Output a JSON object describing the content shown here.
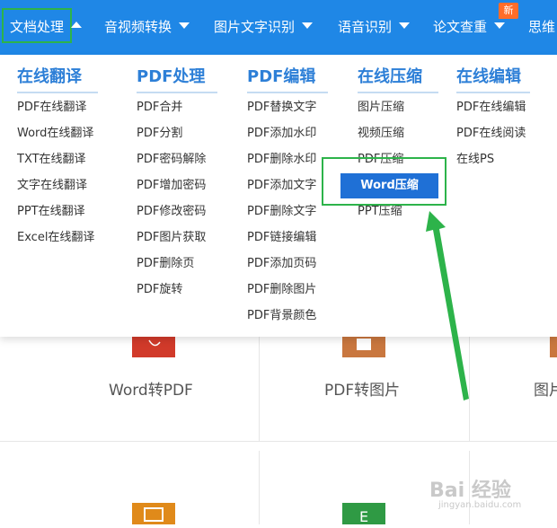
{
  "nav": {
    "items": [
      {
        "label": "文档处理",
        "active": true
      },
      {
        "label": "音视频转换"
      },
      {
        "label": "图片文字识别"
      },
      {
        "label": "语音识别"
      },
      {
        "label": "论文查重",
        "badge": "新"
      },
      {
        "label": "思维"
      }
    ]
  },
  "dropdown": {
    "columns": [
      {
        "title": "在线翻译",
        "items": [
          "PDF在线翻译",
          "Word在线翻译",
          "TXT在线翻译",
          "文字在线翻译",
          "PPT在线翻译",
          "Excel在线翻译"
        ]
      },
      {
        "title": "PDF处理",
        "items": [
          "PDF合并",
          "PDF分割",
          "PDF密码解除",
          "PDF增加密码",
          "PDF修改密码",
          "PDF图片获取",
          "PDF删除页",
          "PDF旋转"
        ]
      },
      {
        "title": "PDF编辑",
        "items": [
          "PDF替换文字",
          "PDF添加水印",
          "PDF删除水印",
          "PDF添加文字",
          "PDF删除文字",
          "PDF链接编辑",
          "PDF添加页码",
          "PDF删除图片",
          "PDF背景颜色"
        ]
      },
      {
        "title": "在线压缩",
        "items": [
          "图片压缩",
          "视频压缩",
          "PDF压缩",
          "Word压缩",
          "PPT压缩"
        ]
      },
      {
        "title": "在线编辑",
        "items": [
          "PDF在线编辑",
          "PDF在线阅读",
          "在线PS"
        ]
      }
    ],
    "highlighted": "Word压缩"
  },
  "cards": {
    "row1": [
      "Word转PDF",
      "PDF转图片",
      "图片"
    ]
  },
  "watermark": {
    "main": "Bai 经验",
    "sub": "jingyan.baidu.com"
  },
  "colors": {
    "nav_bg": "#1f87e6",
    "accent": "#2d7fd7",
    "highlight": "#1f70d6",
    "annotation": "#2db34a"
  }
}
